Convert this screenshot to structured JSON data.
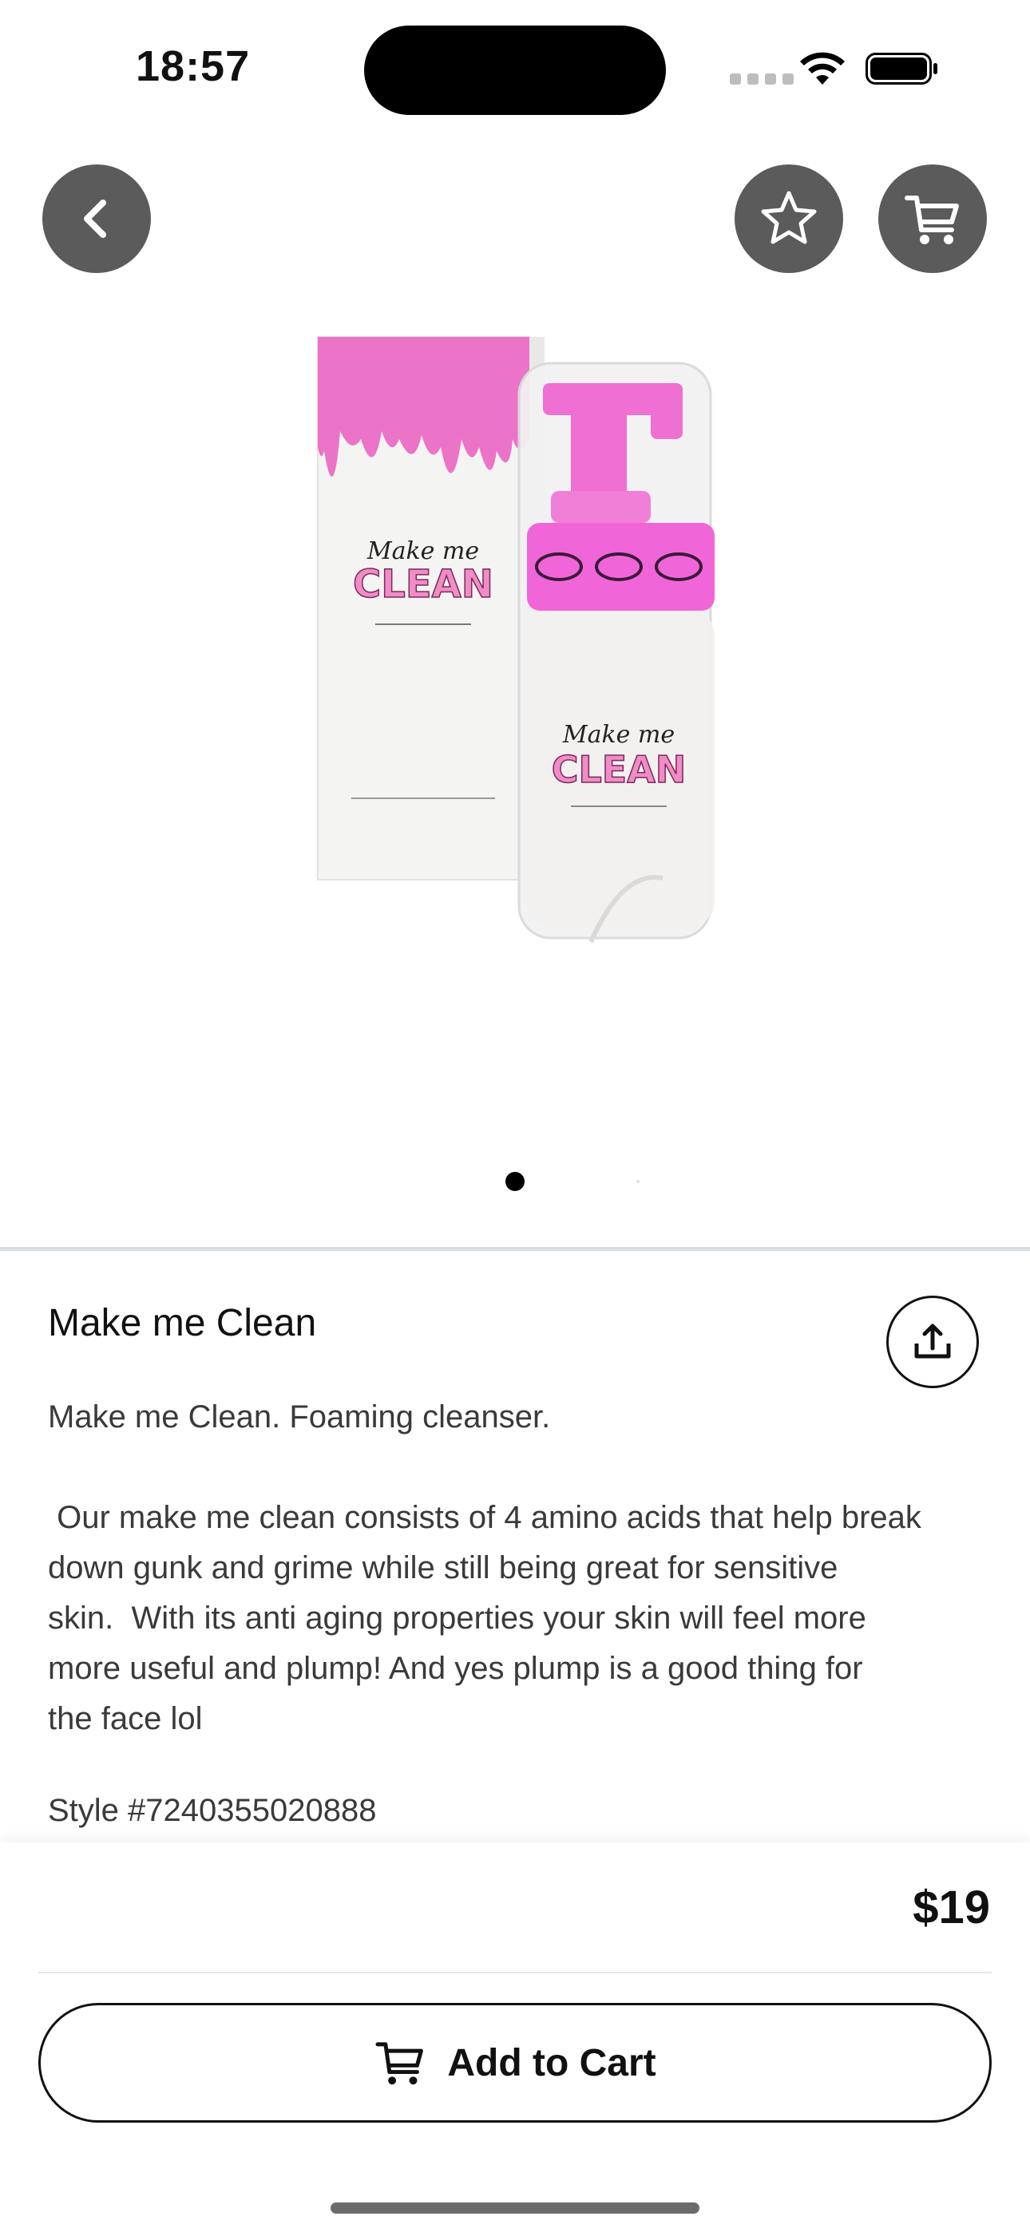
{
  "status_bar": {
    "time": "18:57",
    "icons": [
      "cellular-signal-icon",
      "wifi-icon",
      "battery-icon"
    ]
  },
  "top_bar": {
    "back_icon": "chevron-left-icon",
    "favorite_icon": "star-icon",
    "cart_icon": "cart-icon"
  },
  "gallery": {
    "pages": 2,
    "current_page": 1,
    "image_label_lines": [
      "Make me",
      "CLEAN"
    ]
  },
  "product": {
    "title": "Make me Clean",
    "share_icon": "share-icon",
    "description_lines": [
      "Make me Clean. Foaming cleanser.",
      "",
      " Our make me clean consists of 4 amino acids that help break",
      "down gunk and grime while still being great for sensitive",
      "skin.  With its anti aging properties your skin will feel more",
      "more useful and plump! And yes plump is a good thing for",
      "the face lol"
    ],
    "style_number": "Style #7240355020888"
  },
  "purchase": {
    "price": "$19",
    "add_to_cart_label": "Add to Cart",
    "cart_icon": "cart-icon"
  },
  "colors": {
    "icon_button_bg": "#5b5b5b",
    "pink": "#e878c8",
    "text": "#111111"
  }
}
